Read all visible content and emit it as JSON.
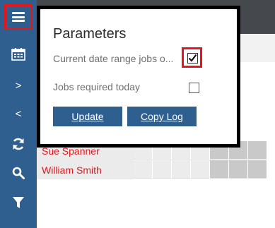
{
  "toolbar": {
    "icons": [
      "menu-icon",
      "calendar-icon",
      "chevron-right-icon",
      "chevron-left-icon",
      "refresh-icon",
      "search-icon",
      "filter-icon"
    ],
    "next_glyph": ">",
    "prev_glyph": "<"
  },
  "rows": [
    {
      "name": "Sue Spanner"
    },
    {
      "name": "William Smith"
    }
  ],
  "parameters": {
    "title": "Parameters",
    "options": [
      {
        "label": "Current date range jobs o...",
        "checked": true
      },
      {
        "label": "Jobs required today",
        "checked": false
      }
    ],
    "update_label": "Update",
    "copy_log_label": "Copy Log"
  },
  "colors": {
    "toolbar_bg": "#2f5f8f",
    "highlight": "#e8141c",
    "button_bg": "#2f5f8f",
    "name_text": "#e8141c"
  }
}
